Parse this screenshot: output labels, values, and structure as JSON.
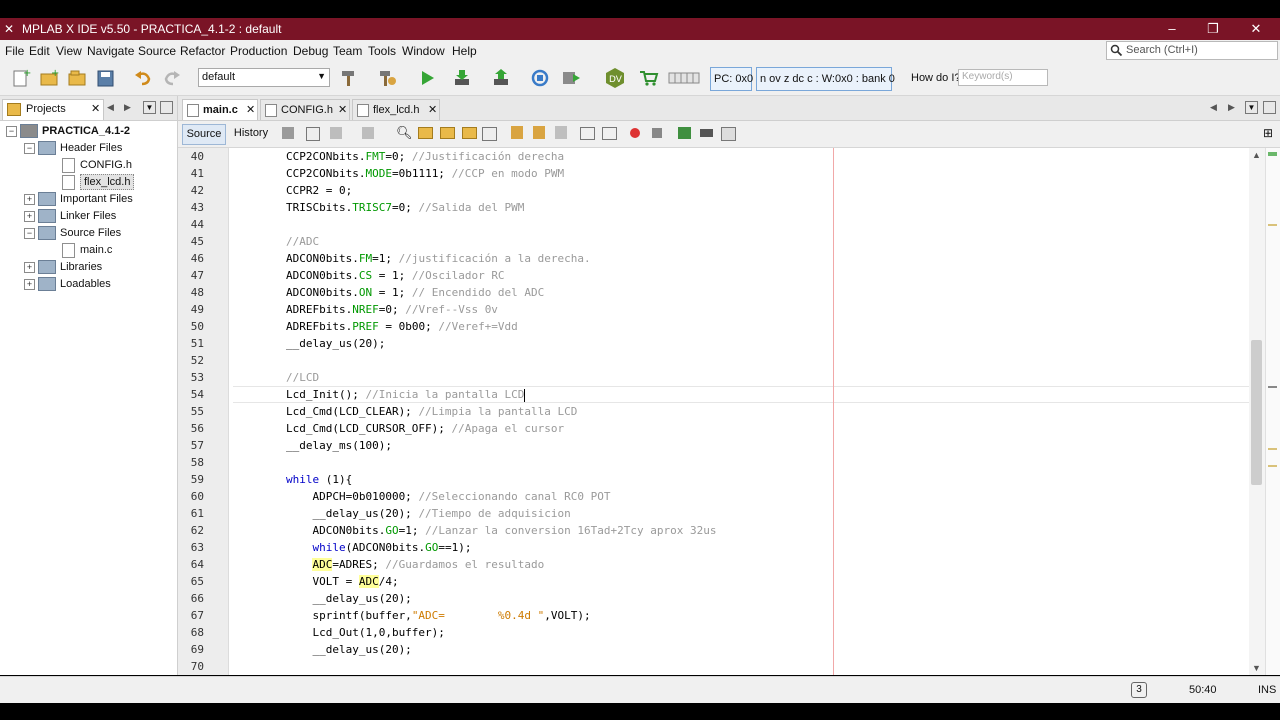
{
  "window": {
    "title": "MPLAB X IDE v5.50 - PRACTICA_4.1-2 : default",
    "controls": [
      "–",
      "❐",
      "✕"
    ]
  },
  "menu": [
    "File",
    "Edit",
    "View",
    "Navigate",
    "Source",
    "Refactor",
    "Production",
    "Debug",
    "Team",
    "Tools",
    "Window",
    "Help"
  ],
  "search": {
    "placeholder": "Search (Ctrl+I)"
  },
  "toolbar": {
    "config": "default",
    "pc": "PC: 0x0",
    "status": "n ov z dc c  : W:0x0 : bank 0",
    "howdoi_label": "How do I?",
    "howdoi_placeholder": "Keyword(s)"
  },
  "projects_panel": {
    "tab": "Projects",
    "tree": [
      {
        "label": "PRACTICA_4.1-2",
        "type": "project",
        "level": 0,
        "exp": "−"
      },
      {
        "label": "Header Files",
        "type": "folder",
        "level": 1,
        "exp": "−"
      },
      {
        "label": "CONFIG.h",
        "type": "file",
        "level": 2,
        "exp": ""
      },
      {
        "label": "flex_lcd.h",
        "type": "file",
        "level": 2,
        "exp": "",
        "selected": true
      },
      {
        "label": "Important Files",
        "type": "folder",
        "level": 1,
        "exp": "+"
      },
      {
        "label": "Linker Files",
        "type": "folder",
        "level": 1,
        "exp": "+"
      },
      {
        "label": "Source Files",
        "type": "folder",
        "level": 1,
        "exp": "−"
      },
      {
        "label": "main.c",
        "type": "file",
        "level": 2,
        "exp": ""
      },
      {
        "label": "Libraries",
        "type": "folder",
        "level": 1,
        "exp": "+"
      },
      {
        "label": "Loadables",
        "type": "folder",
        "level": 1,
        "exp": "+"
      }
    ]
  },
  "editor": {
    "tabs": [
      {
        "label": "main.c",
        "active": true
      },
      {
        "label": "CONFIG.h",
        "active": false
      },
      {
        "label": "flex_lcd.h",
        "active": false
      }
    ],
    "source_btn": "Source",
    "history_btn": "History",
    "current_line": 54,
    "lines": [
      {
        "n": "40",
        "segs": [
          [
            "",
            "        CCP2CONbits."
          ],
          [
            "fld",
            "FMT"
          ],
          [
            "",
            "=0; "
          ],
          [
            "cm",
            "//Justificación derecha"
          ]
        ]
      },
      {
        "n": "41",
        "segs": [
          [
            "",
            "        CCP2CONbits."
          ],
          [
            "fld",
            "MODE"
          ],
          [
            "",
            "=0b1111; "
          ],
          [
            "cm",
            "//CCP en modo PWM"
          ]
        ]
      },
      {
        "n": "42",
        "segs": [
          [
            "",
            "        CCPR2 = 0;"
          ]
        ]
      },
      {
        "n": "43",
        "segs": [
          [
            "",
            "        TRISCbits."
          ],
          [
            "fld",
            "TRISC7"
          ],
          [
            "",
            "=0; "
          ],
          [
            "cm",
            "//Salida del PWM"
          ]
        ]
      },
      {
        "n": "44",
        "segs": []
      },
      {
        "n": "45",
        "segs": [
          [
            "cm",
            "        //ADC"
          ]
        ]
      },
      {
        "n": "46",
        "segs": [
          [
            "",
            "        ADCON0bits."
          ],
          [
            "fld",
            "FM"
          ],
          [
            "",
            "=1; "
          ],
          [
            "cm",
            "//justificación a la derecha."
          ]
        ]
      },
      {
        "n": "47",
        "segs": [
          [
            "",
            "        ADCON0bits."
          ],
          [
            "fld",
            "CS"
          ],
          [
            "",
            " = 1; "
          ],
          [
            "cm",
            "//Oscilador RC"
          ]
        ]
      },
      {
        "n": "48",
        "segs": [
          [
            "",
            "        ADCON0bits."
          ],
          [
            "fld",
            "ON"
          ],
          [
            "",
            " = 1; "
          ],
          [
            "cm",
            "// Encendido del ADC"
          ]
        ]
      },
      {
        "n": "49",
        "segs": [
          [
            "",
            "        ADREFbits."
          ],
          [
            "fld",
            "NREF"
          ],
          [
            "",
            "=0; "
          ],
          [
            "cm",
            "//Vref--Vss 0v"
          ]
        ]
      },
      {
        "n": "50",
        "segs": [
          [
            "",
            "        ADREFbits."
          ],
          [
            "fld",
            "PREF"
          ],
          [
            "",
            " = 0b00; "
          ],
          [
            "cm",
            "//Veref+=Vdd"
          ]
        ]
      },
      {
        "n": "51",
        "segs": [
          [
            "",
            "        __delay_us(20);"
          ]
        ]
      },
      {
        "n": "52",
        "segs": []
      },
      {
        "n": "53",
        "segs": [
          [
            "cm",
            "        //LCD"
          ]
        ]
      },
      {
        "n": "54",
        "segs": [
          [
            "",
            "        Lcd_Init(); "
          ],
          [
            "cm",
            "//Inicia la pantalla LCD"
          ]
        ]
      },
      {
        "n": "55",
        "segs": [
          [
            "",
            "        Lcd_Cmd(LCD_CLEAR); "
          ],
          [
            "cm",
            "//Limpia la pantalla LCD"
          ]
        ]
      },
      {
        "n": "56",
        "segs": [
          [
            "",
            "        Lcd_Cmd(LCD_CURSOR_OFF); "
          ],
          [
            "cm",
            "//Apaga el cursor"
          ]
        ]
      },
      {
        "n": "57",
        "segs": [
          [
            "",
            "        __delay_ms(100);"
          ]
        ]
      },
      {
        "n": "58",
        "segs": []
      },
      {
        "n": "59",
        "segs": [
          [
            "kw",
            "        while"
          ],
          [
            "",
            " (1){"
          ]
        ]
      },
      {
        "n": "60",
        "segs": [
          [
            "",
            "            ADPCH=0b010000; "
          ],
          [
            "cm",
            "//Seleccionando canal RC0 POT"
          ]
        ]
      },
      {
        "n": "61",
        "segs": [
          [
            "",
            "            __delay_us(20); "
          ],
          [
            "cm",
            "//Tiempo de adquisicion"
          ]
        ]
      },
      {
        "n": "62",
        "segs": [
          [
            "",
            "            ADCON0bits."
          ],
          [
            "fld",
            "GO"
          ],
          [
            "",
            "=1; "
          ],
          [
            "cm",
            "//Lanzar la conversion 16Tad+2Tcy aprox 32us"
          ]
        ]
      },
      {
        "n": "63",
        "segs": [
          [
            "kw",
            "            while"
          ],
          [
            "",
            "(ADCON0bits."
          ],
          [
            "fld",
            "GO"
          ],
          [
            "",
            "==1);"
          ]
        ]
      },
      {
        "n": "64",
        "segs": [
          [
            "",
            "            "
          ],
          [
            "hl",
            "ADC"
          ],
          [
            "",
            "=ADRES; "
          ],
          [
            "cm",
            "//Guardamos el resultado"
          ]
        ]
      },
      {
        "n": "65",
        "segs": [
          [
            "",
            "            VOLT = "
          ],
          [
            "hl",
            "ADC"
          ],
          [
            "",
            "/4;"
          ]
        ]
      },
      {
        "n": "66",
        "segs": [
          [
            "",
            "            __delay_us(20);"
          ]
        ]
      },
      {
        "n": "67",
        "segs": [
          [
            "",
            "            sprintf(buffer,"
          ],
          [
            "str",
            "\"ADC=        %0.4d \""
          ],
          [
            "",
            ",VOLT);"
          ]
        ]
      },
      {
        "n": "68",
        "segs": [
          [
            "",
            "            Lcd_Out(1,0,buffer);"
          ]
        ]
      },
      {
        "n": "69",
        "segs": [
          [
            "",
            "            __delay_us(20);"
          ]
        ]
      },
      {
        "n": "70",
        "segs": []
      }
    ]
  },
  "statusbar": {
    "notifications": "3",
    "position": "50:40",
    "mode": "INS"
  }
}
